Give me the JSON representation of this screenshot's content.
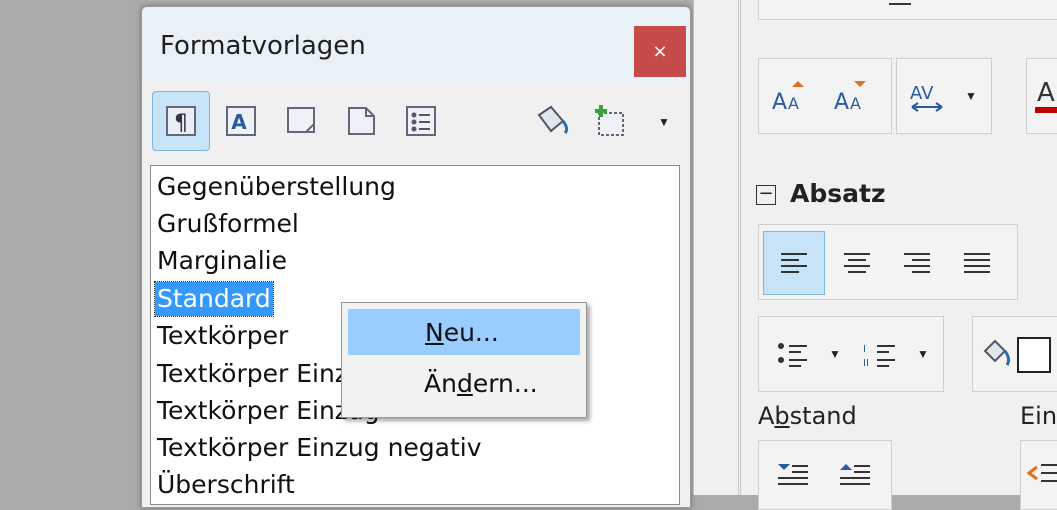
{
  "dialog": {
    "title": "Formatvorlagen",
    "close_label": "×",
    "styles": [
      "Gegenüberstellung",
      "Grußformel",
      "Marginalie",
      "Standard",
      "Textkörper",
      "Textkörper Einzug",
      "Textkörper Einzug",
      "Textkörper Einzug negativ",
      "Überschrift"
    ],
    "selected": "Standard"
  },
  "context_menu": {
    "new": {
      "u": "N",
      "rest": "eu..."
    },
    "edit": {
      "pre": "Än",
      "u": "d",
      "rest": "ern..."
    }
  },
  "sidebar": {
    "paragraph_section": "Absatz",
    "collapse_glyph": "−",
    "spacing": {
      "pre": "A",
      "u": "b",
      "rest": "stand"
    },
    "indent_label": "Ein"
  }
}
